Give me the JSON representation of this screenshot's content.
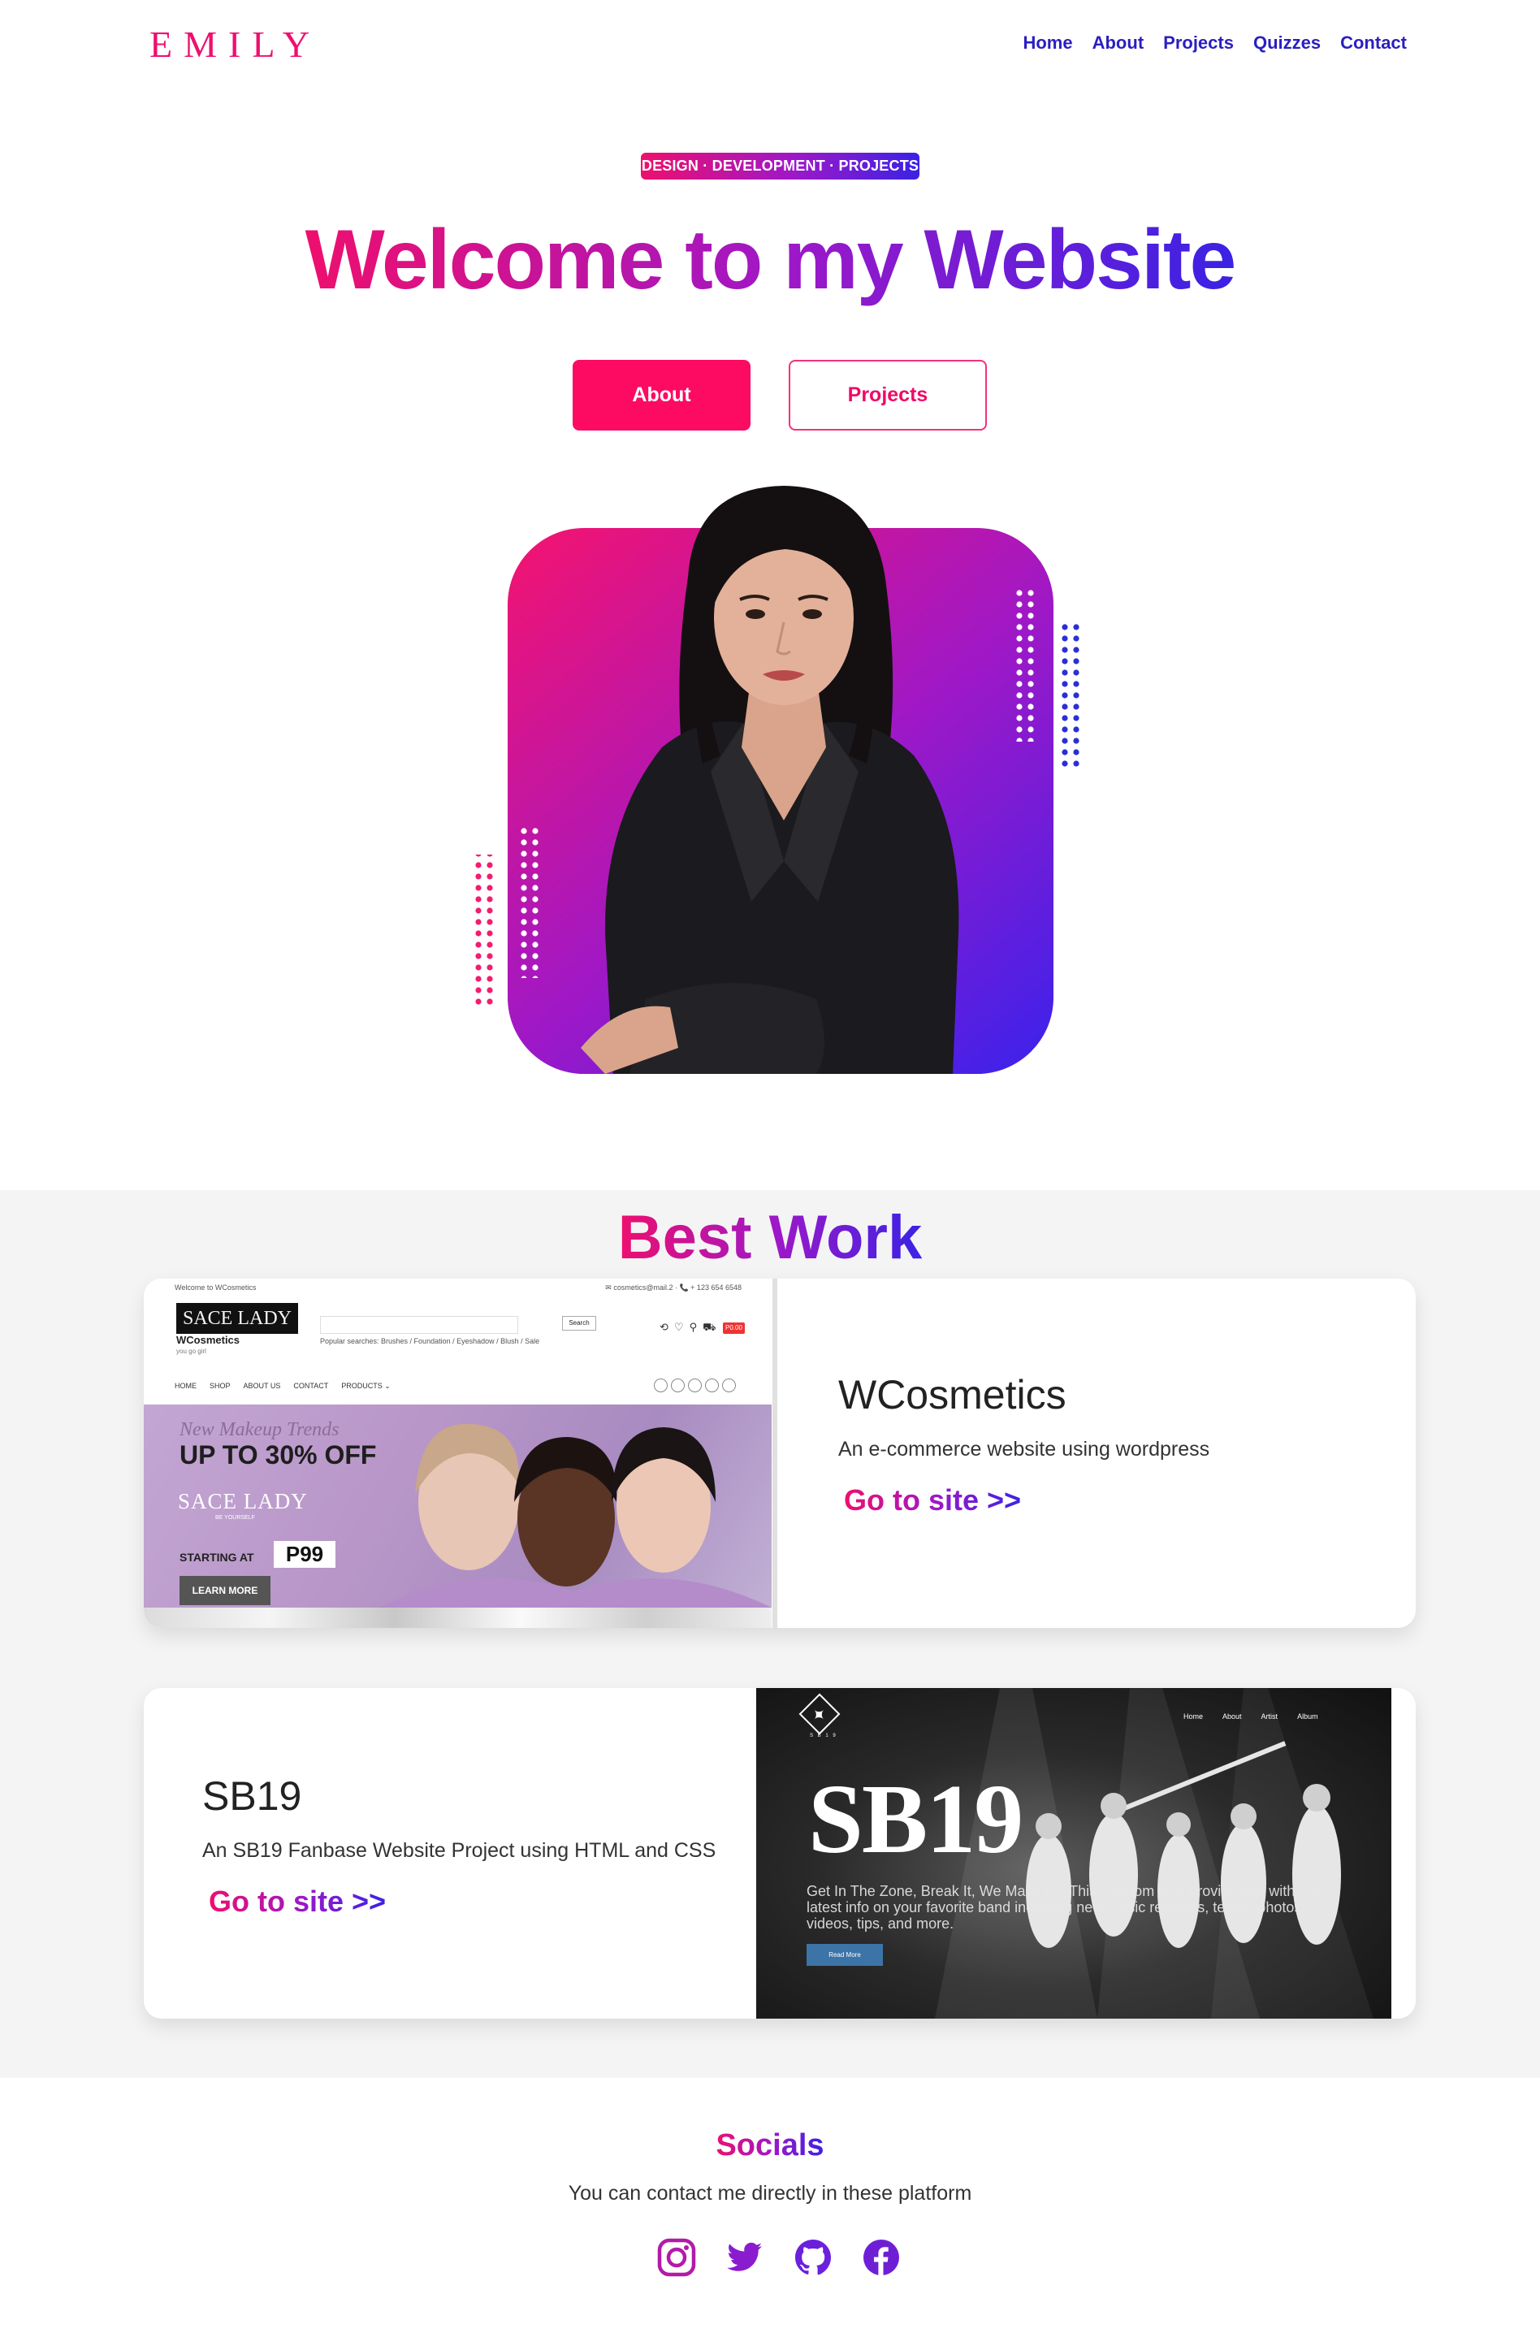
{
  "nav": {
    "logo": "EMILY",
    "links": [
      "Home",
      "About",
      "Projects",
      "Quizzes",
      "Contact"
    ]
  },
  "hero": {
    "badge": "DESIGN · DEVELOPMENT · PROJECTS",
    "title": "Welcome to my Website",
    "primary_button": "About",
    "secondary_button": "Projects"
  },
  "best_work": {
    "title": "Best Work",
    "projects": [
      {
        "title": "WCosmetics",
        "description": "An e-commerce website using wordpress",
        "link": "Go to site >>",
        "preview": {
          "top_left": "Welcome to WCosmetics",
          "top_right": "✉ cosmetics@mail.2 · 📞 + 123 654 6548",
          "logo": "SACE LADY",
          "site_name": "WCosmetics",
          "tagline": "you go girl",
          "search_button": "Search",
          "popular": "Popular searches: Brushes / Foundation / Eyeshadow / Blush / Sale",
          "cart_price": "P0.00",
          "nav_items": [
            "HOME",
            "SHOP",
            "ABOUT US",
            "CONTACT",
            "PRODUCTS ⌄"
          ],
          "banner_script": "New Makeup Trends",
          "banner_headline": "UP TO 30% OFF",
          "banner_brand": "SACE LADY",
          "banner_brand_sub": "BE YOURSELF",
          "banner_starting": "STARTING AT",
          "banner_price": "P99",
          "banner_button": "LEARN MORE"
        }
      },
      {
        "title": "SB19",
        "description": "An SB19 Fanbase Website Project using HTML and CSS",
        "link": "Go to site >>",
        "preview": {
          "logo_text": "S B 1 9",
          "nav_items": [
            "Home",
            "About",
            "Artist",
            "Album"
          ],
          "hero_title": "SB19",
          "body": "Get In The Zone, Break It, We Make It... This Fandom is to provide you with the latest info on your favorite band including new music releases, teaser photos, videos, tips, and more.",
          "button": "Read More"
        }
      }
    ]
  },
  "socials": {
    "title": "Socials",
    "subtitle": "You can contact me directly in these platform",
    "icons": [
      "instagram-icon",
      "twitter-icon",
      "github-icon",
      "facebook-icon"
    ]
  },
  "colors": {
    "pink": "#ee0f6e",
    "purple": "#9d18c8",
    "blue": "#3b22e4",
    "nav": "#2a1fc0",
    "section_bg": "#f4f4f4"
  }
}
